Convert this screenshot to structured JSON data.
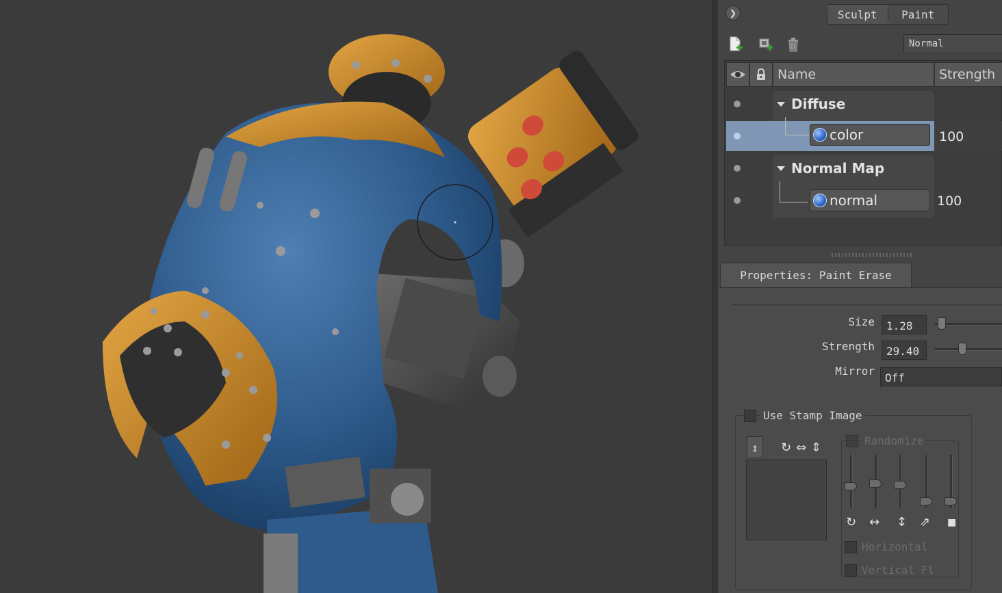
{
  "mode_toggle": {
    "sculpt_label": "Sculpt",
    "paint_label": "Paint",
    "active": "Paint"
  },
  "toolbar": {
    "blend_mode": "Normal",
    "icons": [
      "new-layer-icon",
      "duplicate-layer-icon",
      "delete-layer-icon"
    ]
  },
  "layers_panel": {
    "columns": {
      "name": "Name",
      "strength": "Strength"
    },
    "groups": [
      {
        "name": "Diffuse",
        "layers": [
          {
            "name": "color",
            "strength": "100",
            "selected": true
          }
        ]
      },
      {
        "name": "Normal Map",
        "layers": [
          {
            "name": "normal",
            "strength": "100",
            "selected": false
          }
        ]
      }
    ]
  },
  "properties": {
    "tab_title": "Properties: Paint Erase",
    "size_label": "Size",
    "size_value": "1.28",
    "strength_label": "Strength",
    "strength_value": "29.40",
    "mirror_label": "Mirror",
    "mirror_value": "Off",
    "use_stamp_label": "Use Stamp Image",
    "randomize_label": "Randomize",
    "horizontal_label": "Horizontal",
    "vertical_label": "Vertical Fl"
  },
  "colors": {
    "selection": "#7f97b5",
    "panel": "#444444",
    "armor_blue": "#2f5b8c",
    "armor_gold": "#c98a2e",
    "spots": "#d04a3a"
  }
}
